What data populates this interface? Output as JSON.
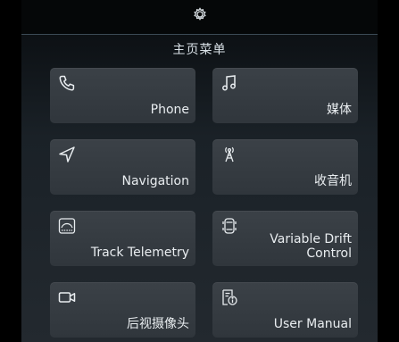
{
  "header": {
    "settings_icon": "settings-gear-icon",
    "title": "主页菜单"
  },
  "tiles": [
    {
      "id": "phone",
      "label": "Phone",
      "icon": "phone-icon"
    },
    {
      "id": "media",
      "label": "媒体",
      "icon": "music-note-icon"
    },
    {
      "id": "navigation",
      "label": "Navigation",
      "icon": "navigation-arrow-icon"
    },
    {
      "id": "radio",
      "label": "收音机",
      "icon": "radio-tower-icon"
    },
    {
      "id": "track-telemetry",
      "label": "Track Telemetry",
      "icon": "telemetry-gauge-icon"
    },
    {
      "id": "variable-drift-control",
      "label_line1": "Variable Drift",
      "label_line2": "Control",
      "icon": "car-drift-icon"
    },
    {
      "id": "camera",
      "label": "后视摄像头",
      "icon": "camera-icon"
    },
    {
      "id": "user-manual",
      "label": "User Manual",
      "icon": "manual-info-icon"
    }
  ],
  "colors": {
    "background": "#000000",
    "panel_top": "#080b0e",
    "panel_bottom": "#23292f",
    "tile": "#363c42",
    "text": "#e9edf0"
  }
}
